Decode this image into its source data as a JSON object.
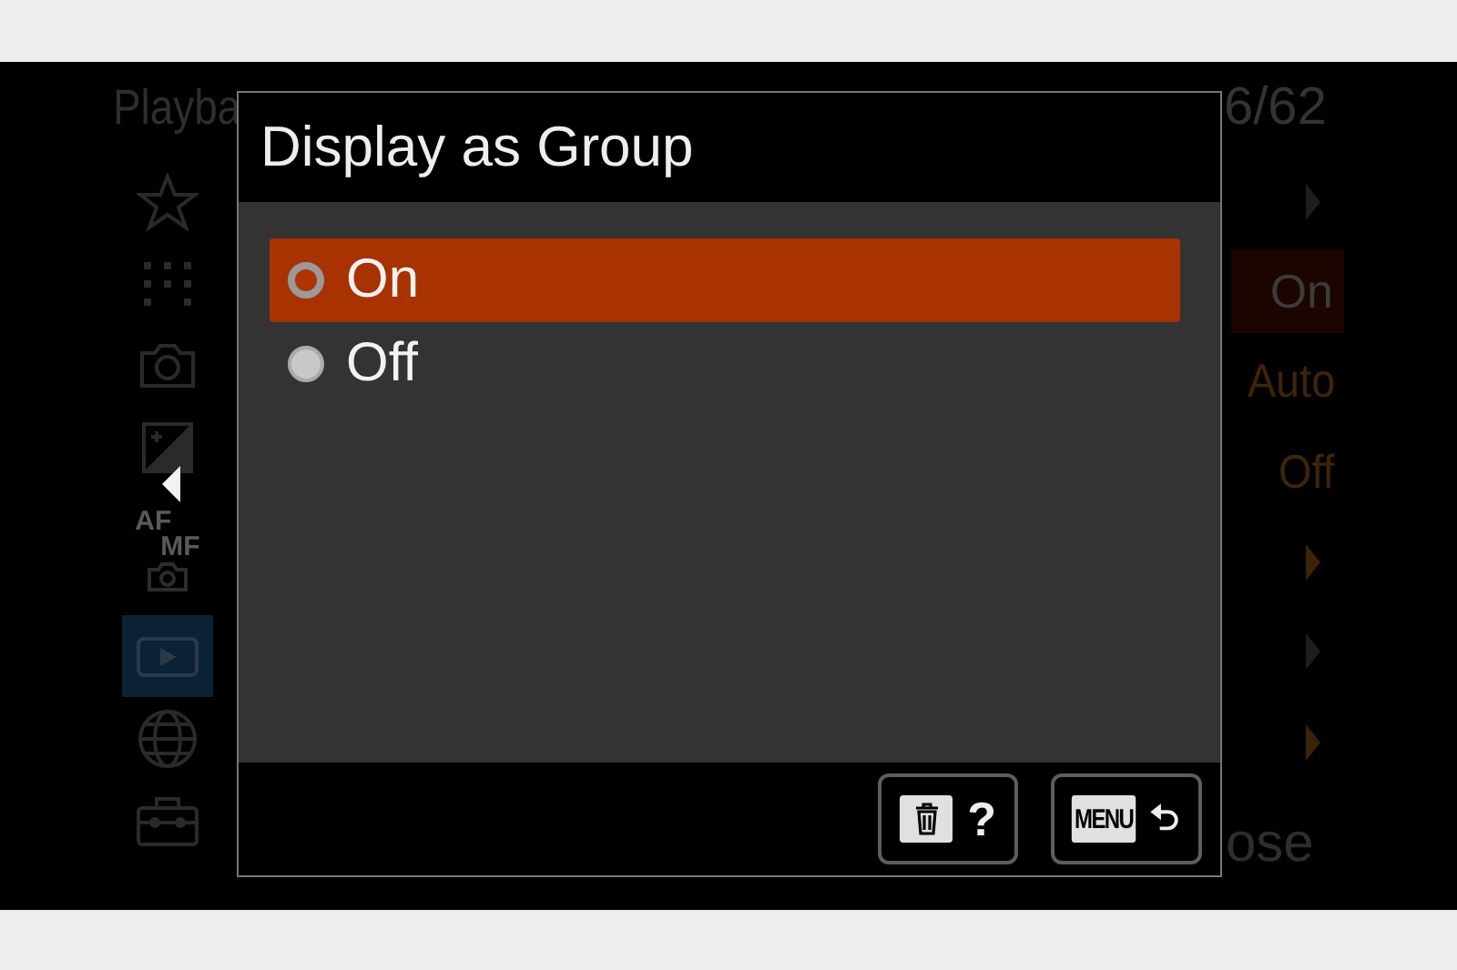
{
  "background_menu": {
    "title": "Playba",
    "page": "6/62",
    "sidebar": [
      {
        "kind": "star",
        "selected": false
      },
      {
        "kind": "dots",
        "selected": false
      },
      {
        "kind": "camera",
        "selected": false
      },
      {
        "kind": "exposure",
        "selected": false
      },
      {
        "kind": "afmf",
        "labels": [
          "AF",
          "MF"
        ],
        "selected": false
      },
      {
        "kind": "playback",
        "selected": true
      },
      {
        "kind": "globe",
        "selected": false
      },
      {
        "kind": "toolbox",
        "selected": false
      }
    ],
    "rows": [
      {
        "kind": "arrow",
        "dimmed": true
      },
      {
        "kind": "value",
        "text": "On",
        "selected": true
      },
      {
        "kind": "value",
        "text": "Auto",
        "selected": false
      },
      {
        "kind": "value",
        "text": "Off",
        "selected": false
      },
      {
        "kind": "arrow",
        "dimmed": false
      },
      {
        "kind": "arrow",
        "dimmed": true
      },
      {
        "kind": "arrow",
        "dimmed": false
      }
    ],
    "footer": "ose"
  },
  "dialog": {
    "title": "Display as Group",
    "options": [
      {
        "label": "On",
        "selected": true
      },
      {
        "label": "Off",
        "selected": false
      }
    ],
    "buttons": [
      {
        "kind": "delete",
        "label": "?"
      },
      {
        "kind": "menu",
        "label": "MENU"
      }
    ]
  }
}
